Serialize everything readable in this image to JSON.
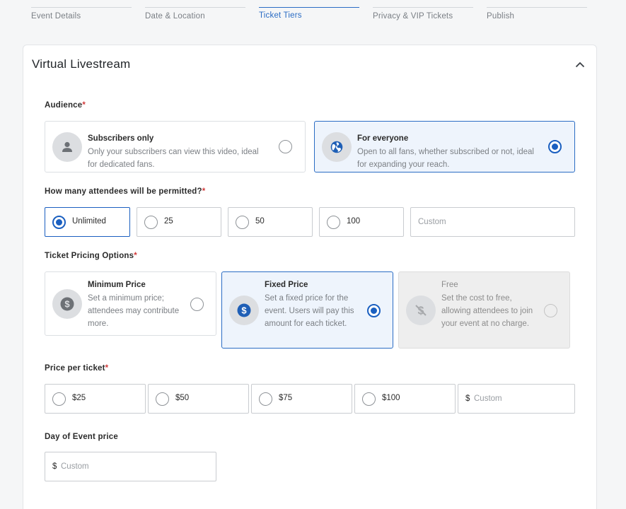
{
  "stepper": {
    "steps": [
      {
        "label": "Event Details"
      },
      {
        "label": "Date & Location"
      },
      {
        "label": "Ticket Tiers"
      },
      {
        "label": "Privacy & VIP Tickets"
      },
      {
        "label": "Publish"
      }
    ],
    "active_index": 2
  },
  "section": {
    "title": "Virtual Livestream",
    "collapse_icon": "chevron-up-icon"
  },
  "audience": {
    "label": "Audience",
    "required_mark": "*",
    "options": [
      {
        "title": "Subscribers only",
        "description": "Only your subscribers can view this video, ideal for dedicated fans.",
        "icon": "person-icon",
        "selected": false
      },
      {
        "title": "For everyone",
        "description": "Open to all fans, whether subscribed or not, ideal for expanding your reach.",
        "icon": "globe-icon",
        "selected": true
      }
    ]
  },
  "attendees": {
    "label": "How many attendees will be permitted?",
    "required_mark": "*",
    "options": [
      {
        "label": "Unlimited",
        "selected": true
      },
      {
        "label": "25",
        "selected": false
      },
      {
        "label": "50",
        "selected": false
      },
      {
        "label": "100",
        "selected": false
      }
    ],
    "custom_placeholder": "Custom"
  },
  "pricing": {
    "label": "Ticket Pricing Options",
    "required_mark": "*",
    "options": [
      {
        "title": "Minimum Price",
        "description": "Set a minimum price; attendees may contribute more.",
        "icon": "dollar-circle-icon",
        "selected": false,
        "disabled": false
      },
      {
        "title": "Fixed Price",
        "description": "Set a fixed price for the event. Users will pay this amount for each ticket.",
        "icon": "dollar-circle-icon",
        "selected": true,
        "disabled": false
      },
      {
        "title": "Free",
        "description": "Set the cost to free, allowing attendees to join your event at no charge.",
        "icon": "no-dollar-icon",
        "selected": false,
        "disabled": true
      }
    ]
  },
  "price_per_ticket": {
    "label": "Price per ticket",
    "required_mark": "*",
    "options": [
      {
        "label": "$25",
        "selected": false
      },
      {
        "label": "$50",
        "selected": false
      },
      {
        "label": "$75",
        "selected": false
      },
      {
        "label": "$100",
        "selected": false
      }
    ],
    "currency_prefix": "$",
    "custom_placeholder": "Custom"
  },
  "day_of_event": {
    "label": "Day of Event price",
    "currency_prefix": "$",
    "custom_placeholder": "Custom"
  },
  "colors": {
    "accent": "#1a5fc0",
    "selected_bg": "#eef4fc",
    "required": "#d23b3b"
  }
}
